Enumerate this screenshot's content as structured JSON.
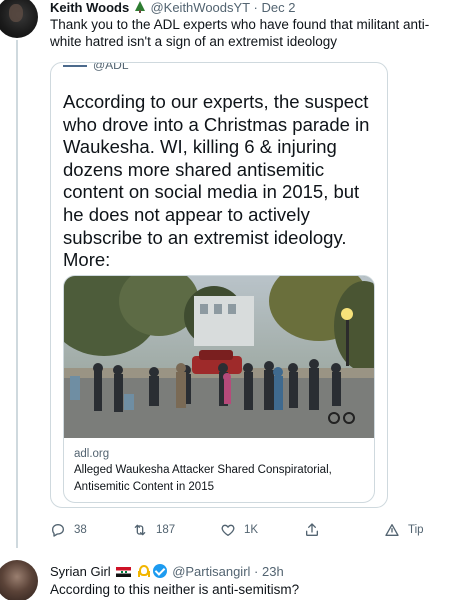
{
  "tweet1": {
    "author_name": "Keith Woods",
    "author_emoji_icon": "christmas-tree-icon",
    "handle": "@KeithWoodsYT",
    "separator": "·",
    "date": "Dec 2",
    "text": "Thank you to the ADL experts who have found that militant anti-white hatred isn't a sign of an extremist ideology",
    "quoted": {
      "handle": "@ADL",
      "text": "According to our experts, the suspect who drove into a Christmas parade in Waukesha. WI, killing 6 & injuring dozens more shared antisemitic content on social media in 2015, but he does not appear to actively subscribe to an extremist ideology. More:",
      "link_card": {
        "domain": "adl.org",
        "title_line1": "Alleged Waukesha Attacker Shared Conspiratorial,",
        "title_line2": "Antisemitic Content in 2015"
      }
    },
    "actions": {
      "replies": "38",
      "retweets": "187",
      "likes": "1K",
      "tip": "Tip"
    }
  },
  "tweet2": {
    "author_name": "Syrian Girl",
    "badges": [
      "syria-flag-icon",
      "ribbon-icon",
      "verified-icon"
    ],
    "handle": "@Partisangirl",
    "separator": "·",
    "date": "23h",
    "text": "According to this neither is anti-semitism?"
  },
  "colors": {
    "text": "#0f1419",
    "secondary": "#536471",
    "border": "#cfd9de",
    "verified": "#1d9bf0"
  }
}
